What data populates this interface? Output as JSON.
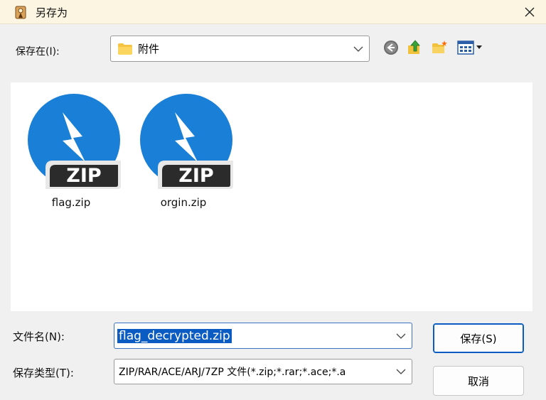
{
  "window": {
    "title": "另存为"
  },
  "look_in": {
    "label": "保存在(I):",
    "value": "附件"
  },
  "toolbar": {
    "icons": [
      "back-icon",
      "up-folder-icon",
      "new-folder-icon",
      "view-menu-icon"
    ]
  },
  "files": [
    {
      "name": "flag.zip",
      "badge": "ZIP"
    },
    {
      "name": "orgin.zip",
      "badge": "ZIP"
    }
  ],
  "filename": {
    "label": "文件名(N):",
    "value": "flag_decrypted.zip"
  },
  "filetype": {
    "label": "保存类型(T):",
    "value": "ZIP/RAR/ACE/ARJ/7ZP 文件(*.zip;*.rar;*.ace;*.a"
  },
  "buttons": {
    "save": "保存(S)",
    "cancel": "取消"
  },
  "colors": {
    "zip_blue": "#1a7fd6",
    "selection": "#0a5cc2",
    "titlebar": "#fbf5e2"
  }
}
